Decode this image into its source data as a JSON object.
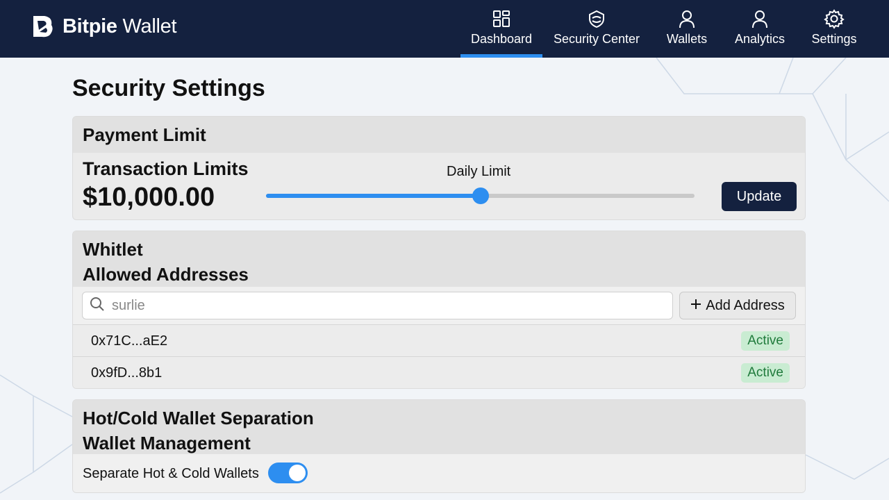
{
  "app": {
    "brand_bold": "Bitpie",
    "brand_rest": " Wallet"
  },
  "nav": [
    {
      "label": "Dashboard",
      "icon": "grid-icon",
      "active": true
    },
    {
      "label": "Security Center",
      "icon": "shield-icon",
      "active": false
    },
    {
      "label": "Wallets",
      "icon": "user-icon",
      "active": false
    },
    {
      "label": "Analytics",
      "icon": "user-icon",
      "active": false
    },
    {
      "label": "Settings",
      "icon": "gear-icon",
      "active": false
    }
  ],
  "page": {
    "title": "Security Settings"
  },
  "payment": {
    "heading": "Payment Limit",
    "sub_heading": "Transaction Limits",
    "amount": "$10,000.00",
    "slider_label": "Daily Limit",
    "slider_value_fraction": 0.5,
    "update_label": "Update"
  },
  "whitelist": {
    "heading_line1": "Whitlet",
    "heading_line2": "Allowed Addresses",
    "search_value": "surlie",
    "add_label": "Add Address",
    "addresses": [
      {
        "address": "0x71C...aE2",
        "status": "Active"
      },
      {
        "address": "0x9fD...8b1",
        "status": "Active"
      }
    ]
  },
  "hotcold": {
    "heading_line1": "Hot/Cold Wallet Separation",
    "heading_line2": "Wallet Management",
    "toggle_label": "Separate Hot & Cold Wallets",
    "toggle_on": true
  },
  "colors": {
    "header_bg": "#14213f",
    "accent": "#2d8ef0",
    "badge_bg": "#c9ecd2",
    "badge_text": "#1f7a3b"
  }
}
